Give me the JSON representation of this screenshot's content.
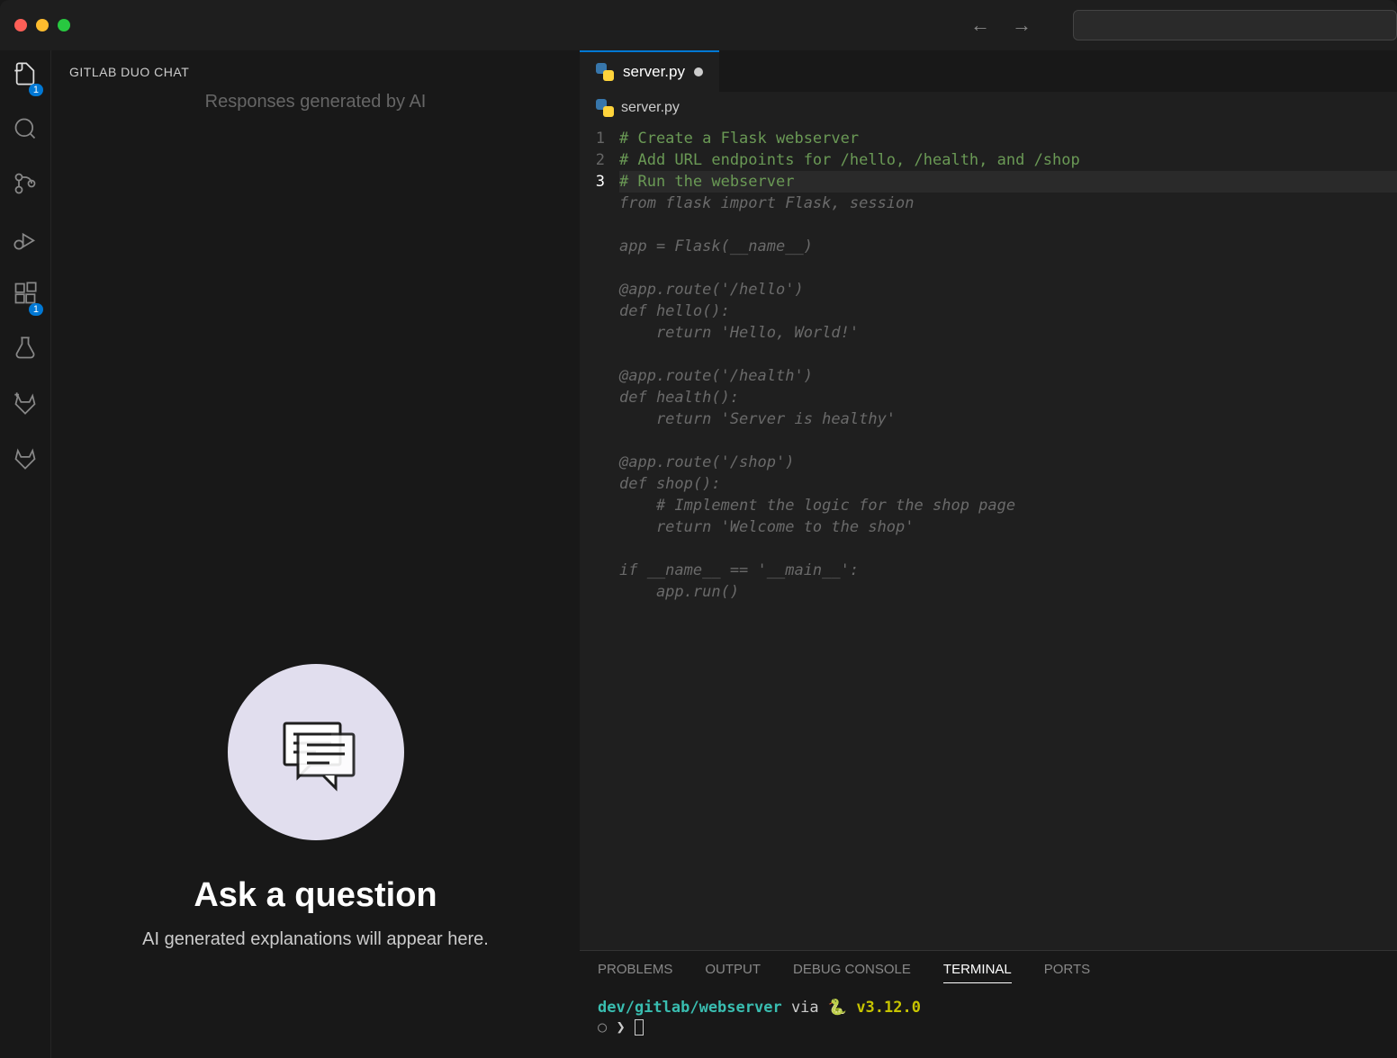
{
  "titlebar": {},
  "activitybar": {
    "explorer_badge": "1",
    "extensions_badge": "1"
  },
  "chatpanel": {
    "header": "GITLAB DUO CHAT",
    "subheader": "Responses generated by AI",
    "empty_title": "Ask a question",
    "empty_sub": "AI generated explanations will appear here."
  },
  "editor": {
    "tab_label": "server.py",
    "breadcrumb": "server.py",
    "gutter": [
      "1",
      "2",
      "3"
    ],
    "lines": [
      {
        "cls": "comment",
        "text": "# Create a Flask webserver"
      },
      {
        "cls": "comment",
        "text": "# Add URL endpoints for /hello, /health, and /shop"
      },
      {
        "cls": "comment ghostactive",
        "text": "# Run the webserver"
      },
      {
        "cls": "ghost",
        "text": "from flask import Flask, session"
      },
      {
        "cls": "ghost",
        "text": ""
      },
      {
        "cls": "ghost",
        "text": "app = Flask(__name__)"
      },
      {
        "cls": "ghost",
        "text": ""
      },
      {
        "cls": "ghost",
        "text": "@app.route('/hello')"
      },
      {
        "cls": "ghost",
        "text": "def hello():"
      },
      {
        "cls": "ghost",
        "text": "    return 'Hello, World!'"
      },
      {
        "cls": "ghost",
        "text": ""
      },
      {
        "cls": "ghost",
        "text": "@app.route('/health')"
      },
      {
        "cls": "ghost",
        "text": "def health():"
      },
      {
        "cls": "ghost",
        "text": "    return 'Server is healthy'"
      },
      {
        "cls": "ghost",
        "text": ""
      },
      {
        "cls": "ghost",
        "text": "@app.route('/shop')"
      },
      {
        "cls": "ghost",
        "text": "def shop():"
      },
      {
        "cls": "ghost",
        "text": "    # Implement the logic for the shop page"
      },
      {
        "cls": "ghost",
        "text": "    return 'Welcome to the shop'"
      },
      {
        "cls": "ghost",
        "text": ""
      },
      {
        "cls": "ghost",
        "text": "if __name__ == '__main__':"
      },
      {
        "cls": "ghost",
        "text": "    app.run()"
      }
    ]
  },
  "panel": {
    "tabs": {
      "problems": "PROBLEMS",
      "output": "OUTPUT",
      "debug": "DEBUG CONSOLE",
      "terminal": "TERMINAL",
      "ports": "PORTS"
    },
    "terminal": {
      "path": "dev/gitlab/webserver",
      "via": " via ",
      "snake": "🐍",
      "version": "v3.12.0",
      "prompt_circle": "○",
      "prompt_chevron": "❯"
    }
  }
}
